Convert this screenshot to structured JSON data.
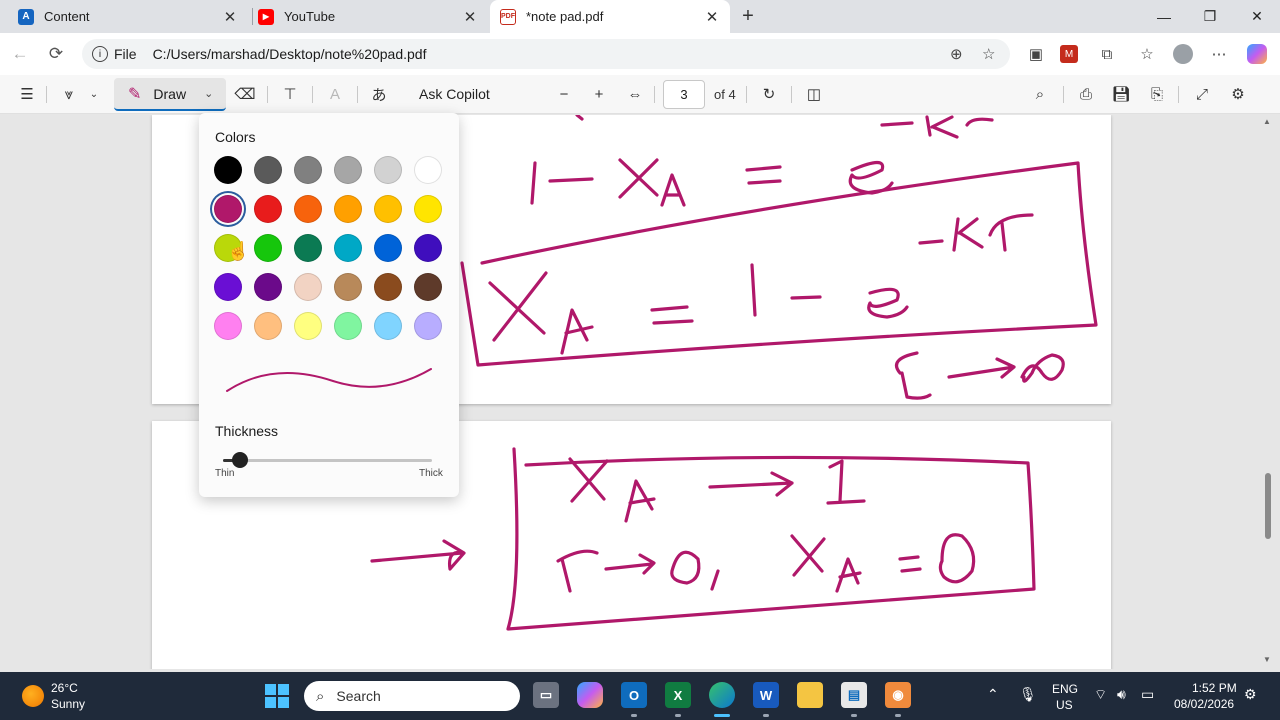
{
  "browser": {
    "tabs": [
      {
        "title": "Content",
        "favicon": "canvas-a-icon",
        "active": false
      },
      {
        "title": "YouTube",
        "favicon": "youtube-icon",
        "active": false
      },
      {
        "title": "*note pad.pdf",
        "favicon": "pdf-icon",
        "active": true
      }
    ],
    "address": {
      "scheme_label": "File",
      "url": "C:/Users/marshad/Desktop/note%20pad.pdf"
    }
  },
  "pdf_toolbar": {
    "draw_label": "Draw",
    "ask_copilot_label": "Ask Copilot",
    "page_number": "3",
    "page_total_label": "of 4"
  },
  "draw_flyout": {
    "colors_heading": "Colors",
    "selected_color": "#b0186a",
    "colors": [
      [
        "#000000",
        "#5a5a5a",
        "#808080",
        "#a6a6a6",
        "#d2d2d2",
        "#ffffff"
      ],
      [
        "#b0186a",
        "#e81c1c",
        "#f7630c",
        "#ffa000",
        "#ffc000",
        "#ffe500"
      ],
      [
        "#bad80a",
        "#16c60c",
        "#0b7a53",
        "#00a8c6",
        "#0063d8",
        "#3f0ebd"
      ],
      [
        "#6a0fd4",
        "#6b0a8a",
        "#f2d3c3",
        "#b8895a",
        "#8a4b1e",
        "#5e3a2a"
      ],
      [
        "#ff80f0",
        "#ffbf7f",
        "#ffff80",
        "#80f5a0",
        "#80d4ff",
        "#b8adff"
      ]
    ],
    "thickness_heading": "Thickness",
    "thickness_level": 0.08,
    "thin_label": "Thin",
    "thick_label": "Thick"
  },
  "taskbar": {
    "weather_temp": "26°C",
    "weather_desc": "Sunny",
    "search_placeholder": "Search",
    "lang_top": "ENG",
    "lang_bottom": "US",
    "time": "1:52 PM",
    "date": "08/02/2026"
  }
}
